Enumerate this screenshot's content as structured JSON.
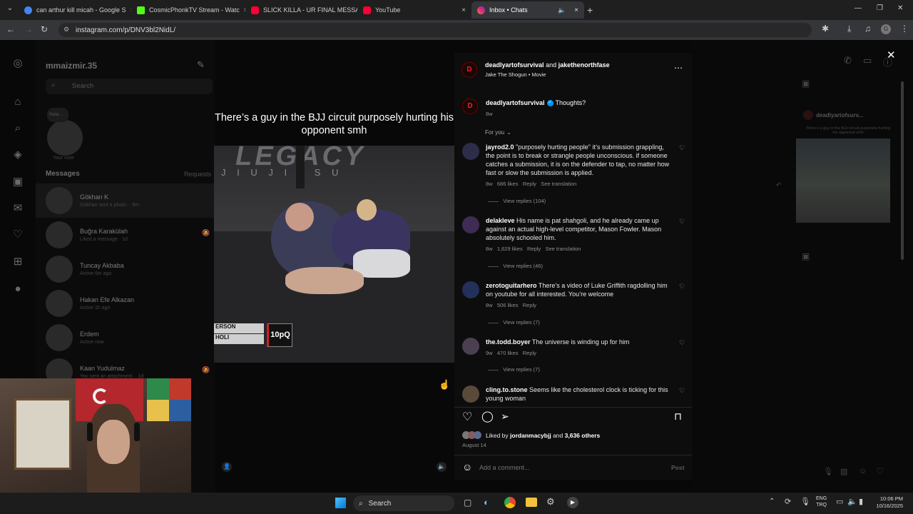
{
  "browser": {
    "tabs": [
      {
        "title": "can arthur kill micah - Google S",
        "color": "#4285f4",
        "close": "×"
      },
      {
        "title": "CosmicPhonkTV Stream - Watc",
        "color": "#53fc18",
        "close": "×"
      },
      {
        "title": "SLICK KILLA - UR FINAL MESSA",
        "color": "#ff0033",
        "close": "×"
      },
      {
        "title": "YouTube",
        "color": "#ff0033",
        "close": "×"
      },
      {
        "title": "Inbox • Chats",
        "color": "#e1306c",
        "close": "×"
      }
    ],
    "new_tab": "+",
    "url": "instagram.com/p/DNV3bl2NidL/",
    "window_controls": {
      "minimize": "—",
      "maximize": "❐",
      "close": "✕"
    }
  },
  "sidebar": {
    "username": "mmaizmir.35",
    "search_placeholder": "Search",
    "note_label": "Note...",
    "your_note": "Your note",
    "messages_heading": "Messages",
    "requests_label": "Requests",
    "conversations": [
      {
        "name": "Gökhan K",
        "sub": "Gökhan sent a photo. · 9m"
      },
      {
        "name": "Buğra Karakülah",
        "sub": "Liked a message · 1d"
      },
      {
        "name": "Tuncay Akbaba",
        "sub": "Active 6m ago"
      },
      {
        "name": "Hakan Efe Alkazan",
        "sub": "Active 1h ago"
      },
      {
        "name": "Erdem",
        "sub": "Active now"
      },
      {
        "name": "Kaan Yudulmaz",
        "sub": "You sent an attachment. · 1d"
      }
    ]
  },
  "video": {
    "caption": "There’s a guy in the BJJ circuit purposely hurting his opponent smh",
    "banner_text": "LEGACY",
    "banner_sub": "J I U   J I T S U",
    "score_names": [
      "ERSON",
      "HOLI"
    ],
    "score_tag": "10pQ"
  },
  "post": {
    "author": "deadlyartofsurvival",
    "and": "and",
    "coauthor": "jakethenorthfase",
    "audio": "Jake The Shogun • Movie",
    "caption_user": "deadlyartofsurvival",
    "caption_text": "Thoughts?",
    "caption_age": "8w",
    "sort_label": "For you",
    "comments": [
      {
        "user": "jayrod2.0",
        "text": "\"purposely hurting people\" it’s submission grappling, the point is to break or strangle people unconscious. if someone catches a submission, it is on the defender to tap, no matter how fast or slow the submission is applied.",
        "age": "8w",
        "likes": "686 likes",
        "reply": "Reply",
        "translate": "See translation",
        "view_replies": "View replies (104)"
      },
      {
        "user": "delakleve",
        "text": "His name is pat shahgoli, and he already came up against an actual high-level competitor, Mason Fowler. Mason absolutely schooled him.",
        "age": "8w",
        "likes": "1,629 likes",
        "reply": "Reply",
        "translate": "See translation",
        "view_replies": "View replies (46)"
      },
      {
        "user": "zerotoguitarhero",
        "text": "There’s a video of Luke Griffith ragdolling him on youtube for all interested. You’re welcome",
        "age": "8w",
        "likes": "506 likes",
        "reply": "Reply",
        "translate": "",
        "view_replies": "View replies (7)"
      },
      {
        "user": "the.todd.boyer",
        "text": "The universe is winding up for him",
        "age": "9w",
        "likes": "470 likes",
        "reply": "Reply",
        "translate": "",
        "view_replies": "View replies (7)"
      },
      {
        "user": "cling.to.stone",
        "text": "Seems like the cholesterol clock is ticking for this young woman",
        "age": "",
        "likes": "",
        "reply": "",
        "translate": "",
        "view_replies": ""
      }
    ],
    "liked_by_prefix": "Liked by",
    "liked_by_user": "jordanmacybjj",
    "liked_by_and": "and",
    "liked_by_others": "3,636 others",
    "date": "August 14",
    "comment_placeholder": "Add a comment...",
    "post_button": "Post"
  },
  "chat_preview": {
    "author": "deadlyartofsurv...",
    "caption": "There’s a guy in the BJJ circuit purposely hurting his opponent smh"
  },
  "taskbar": {
    "search_label": "Search",
    "lang_top": "ENG",
    "lang_bottom": "TRQ",
    "time": "10:06 PM",
    "date": "10/16/2025"
  },
  "colors": {
    "accent": "#0095f6",
    "verified": "#0095f6",
    "brand_ig": "#e1306c"
  }
}
